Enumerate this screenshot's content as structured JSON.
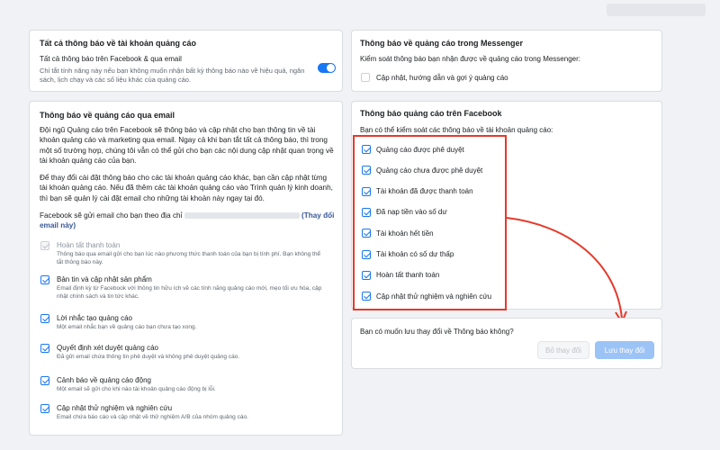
{
  "all_notifications": {
    "title": "Tất cả thông báo về tài khoản quảng cáo",
    "subtitle": "Tất cả thông báo trên Facebook & qua email",
    "description": "Chỉ tắt tính năng này nếu bạn không muốn nhận bất kỳ thông báo nào về hiệu quả, ngân sách, lịch chạy và các số liệu khác của quảng cáo.",
    "toggle_on": true
  },
  "email": {
    "title": "Thông báo về quảng cáo qua email",
    "para1": "Đội ngũ Quảng cáo trên Facebook sẽ thông báo và cập nhật cho bạn thông tin về tài khoản quảng cáo và marketing qua email. Ngay cả khi bạn tắt tất cả thông báo, thì trong một số trường hợp, chúng tôi vẫn có thể gửi cho bạn các nội dung cập nhật quan trọng về tài khoản quảng cáo của bạn.",
    "para2": "Để thay đổi cài đặt thông báo cho các tài khoản quảng cáo khác, bạn cần cập nhật từng tài khoản quảng cáo. Nếu đã thêm các tài khoản quảng cáo vào Trình quản lý kinh doanh, thì bạn sẽ quản lý cài đặt email cho những tài khoản này ngay tại đó.",
    "send_to_prefix": "Facebook sẽ gửi email cho bạn theo địa chỉ",
    "change_email_link": "(Thay đổi email này)",
    "items": [
      {
        "label": "Hoàn tất thanh toán",
        "desc": "Thông báo qua email gửi cho bạn lúc nào phương thức thanh toán của bạn bị tính phí. Bạn không thể tắt thông báo này.",
        "state": "disabled"
      },
      {
        "label": "Bản tin và cập nhật sản phẩm",
        "desc": "Email định kỳ từ Facebook với thông tin hữu ích về các tính năng quảng cáo mới, mẹo tối ưu hóa, cập nhật chính sách và tin tức khác.",
        "state": "on"
      },
      {
        "label": "Lời nhắc tạo quảng cáo",
        "desc": "Một email nhắc bạn về quảng cáo bạn chưa tạo xong.",
        "state": "on"
      },
      {
        "label": "Quyết định xét duyệt quảng cáo",
        "desc": "Đã gửi email chứa thông tin phê duyệt và không phê duyệt quảng cáo.",
        "state": "on"
      },
      {
        "label": "Cảnh báo về quảng cáo động",
        "desc": "Một email sẽ gửi cho khi nào tài khoản quảng cáo động bị lỗi.",
        "state": "on"
      },
      {
        "label": "Cập nhật thử nghiệm và nghiên cứu",
        "desc": "Email chứa báo cáo và cập nhật về thử nghiệm A/B của nhóm quảng cáo.",
        "state": "on"
      }
    ]
  },
  "messenger": {
    "title": "Thông báo về quảng cáo trong Messenger",
    "description": "Kiểm soát thông báo bạn nhận được về quảng cáo trong Messenger:",
    "item_label": "Cập nhật, hướng dẫn và gợi ý quảng cáo",
    "item_checked": false
  },
  "facebook": {
    "title": "Thông báo quảng cáo trên Facebook",
    "description": "Bạn có thể kiểm soát các thông báo về tài khoản quảng cáo:",
    "items": [
      "Quảng cáo được phê duyệt",
      "Quảng cáo chưa được phê duyệt",
      "Tài khoản đã được thanh toán",
      "Đã nạp tiền vào số dư",
      "Tài khoản hết tiền",
      "Tài khoản có số dư thấp",
      "Hoàn tất thanh toán",
      "Cập nhật thử nghiệm và nghiên cứu"
    ]
  },
  "save_prompt": {
    "question": "Bạn có muốn lưu thay đổi về Thông báo không?",
    "cancel_label": "Bỏ thay đổi",
    "save_label": "Lưu thay đổi"
  },
  "colors": {
    "accent": "#1877f2",
    "annotation": "#e53a2c"
  }
}
